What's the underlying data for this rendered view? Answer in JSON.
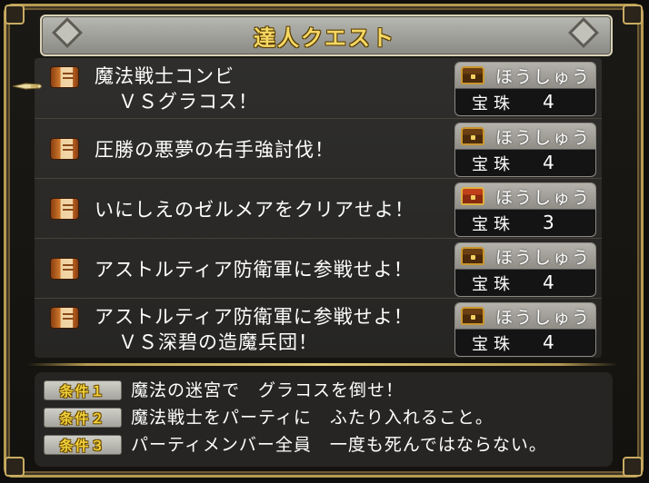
{
  "window": {
    "title": "達人クエスト"
  },
  "quests": [
    {
      "name_lines": [
        "魔法戦士コンビ",
        "ＶＳグラコス！"
      ],
      "reward_label": "ほうしゅう",
      "reward_item": "宝珠",
      "reward_count": "4 こ",
      "chest": "brown",
      "selected": true
    },
    {
      "name_lines": [
        "圧勝の悪夢の右手強討伐！"
      ],
      "reward_label": "ほうしゅう",
      "reward_item": "宝珠",
      "reward_count": "4 こ",
      "chest": "brown",
      "selected": false
    },
    {
      "name_lines": [
        "いにしえのゼルメアをクリアせよ！"
      ],
      "reward_label": "ほうしゅう",
      "reward_item": "宝珠",
      "reward_count": "3 こ",
      "chest": "red",
      "selected": false
    },
    {
      "name_lines": [
        "アストルティア防衛軍に参戦せよ！"
      ],
      "reward_label": "ほうしゅう",
      "reward_item": "宝珠",
      "reward_count": "4 こ",
      "chest": "brown",
      "selected": false
    },
    {
      "name_lines": [
        "アストルティア防衛軍に参戦せよ！",
        "ＶＳ深碧の造魔兵団！"
      ],
      "reward_label": "ほうしゅう",
      "reward_item": "宝珠",
      "reward_count": "4 こ",
      "chest": "brown",
      "selected": false
    }
  ],
  "conditions": [
    {
      "label": "条件１",
      "text": "魔法の迷宮で　グラコスを倒せ！"
    },
    {
      "label": "条件２",
      "text": "魔法戦士をパーティに　ふたり入れること。"
    },
    {
      "label": "条件３",
      "text": "パーティメンバー全員　一度も死んではならない。"
    }
  ],
  "colors": {
    "accent_gold": "#f6d864",
    "frame_gold": "#b59a52",
    "panel": "#2f2e2c"
  },
  "icons": {
    "quest": "quest-scroll-icon",
    "reward": "treasure-chest-icon",
    "cursor": "hand-cursor-icon"
  }
}
